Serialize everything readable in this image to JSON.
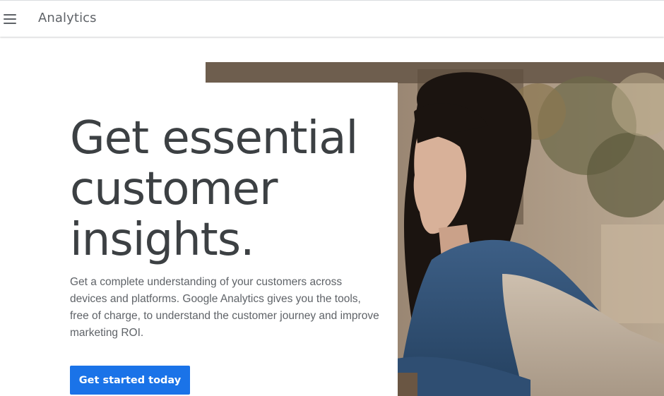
{
  "header": {
    "menu_icon": "hamburger-menu-icon",
    "brand": "Analytics"
  },
  "hero": {
    "headline_lines": [
      "Get essential",
      "customer",
      "insights."
    ],
    "description": "Get a complete understanding of your customers across devices and platforms. Google Analytics gives you the tools, free of charge, to understand the customer journey and improve marketing ROI.",
    "cta_label": "Get started today",
    "image_subject": "woman-at-cafe-photo"
  },
  "colors": {
    "cta": "#1a73e8",
    "headline": "#3c4043",
    "body_text": "#5f6368"
  }
}
